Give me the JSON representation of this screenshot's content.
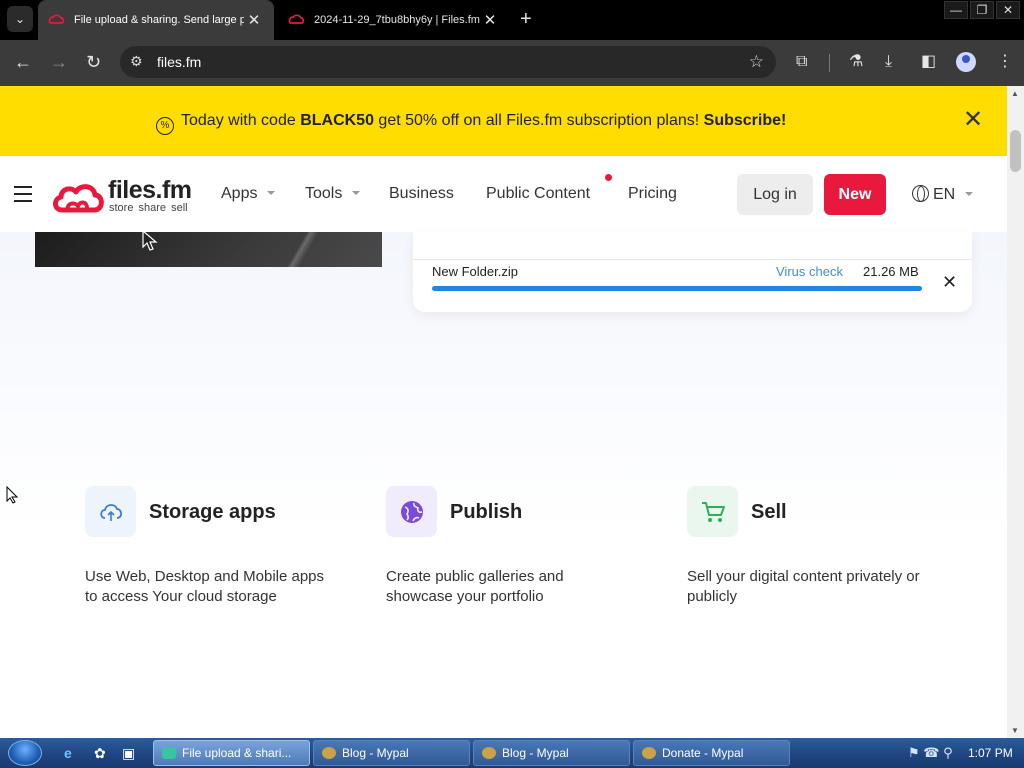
{
  "browser": {
    "tabs": [
      {
        "title": "File upload & sharing. Send large pl",
        "active": true
      },
      {
        "title": "2024-11-29_7tbu8bhy6y | Files.fm",
        "active": false
      }
    ],
    "url": "files.fm"
  },
  "promo": {
    "prefix": "Today with code ",
    "code": "BLACK50",
    "middle": " get 50% off on all Files.fm subscription plans! ",
    "cta": "Subscribe!"
  },
  "header": {
    "logo_name": "files.fm",
    "logo_tagline": "store share sell",
    "nav": [
      "Apps",
      "Tools",
      "Business",
      "Public Content",
      "Pricing"
    ],
    "login": "Log in",
    "new": "New",
    "lang": "EN"
  },
  "upload": {
    "file_name": "New Folder.zip",
    "status_link": "Virus check",
    "size": "21.26 MB",
    "progress": 1.0
  },
  "features": [
    {
      "title": "Storage apps",
      "desc": "Use Web, Desktop and Mobile apps to access Your cloud storage",
      "icon": "cloud-sync-icon",
      "bg": "#eef4fc",
      "color": "#3a7bd5"
    },
    {
      "title": "Publish",
      "desc": "Create public galleries and showcase your portfolio",
      "icon": "globe-icon",
      "bg": "#f1ecfb",
      "color": "#7a4bd6"
    },
    {
      "title": "Sell",
      "desc": "Sell your digital content privately or publicly",
      "icon": "cart-icon",
      "bg": "#eaf7ee",
      "color": "#2fae5a"
    }
  ],
  "taskbar": {
    "windows": [
      {
        "title": "File upload & shari...",
        "active": true
      },
      {
        "title": "Blog - Mypal",
        "active": false
      },
      {
        "title": "Blog - Mypal",
        "active": false
      },
      {
        "title": "Donate - Mypal",
        "active": false
      }
    ],
    "clock": "1:07 PM"
  },
  "colors": {
    "brand_red": "#e8193c",
    "promo_yellow": "#ffdd00",
    "progress_blue": "#1f87e0"
  }
}
